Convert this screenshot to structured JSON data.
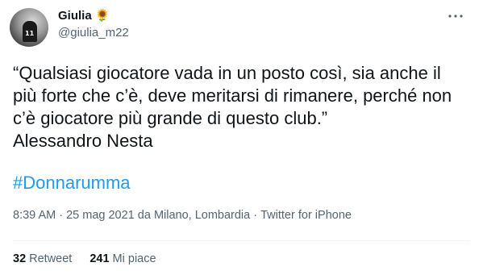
{
  "author": {
    "display_name": "Giulia",
    "emoji": "🌻",
    "handle": "@giulia_m22",
    "avatar_number": "11"
  },
  "tweet": {
    "text": "“Qualsiasi giocatore vada in un posto così, sia anche il\npiù forte che c’è, deve meritarsi di rimanere, perché non\nc’è giocatore più grande di questo club.”\nAlessandro Nesta",
    "hashtag": "#Donnarumma"
  },
  "meta": {
    "time": "8:39 AM",
    "sep1": " · ",
    "date": "25 mag 2021",
    "da": " da ",
    "location": "Milano, Lombardia",
    "sep2": " · ",
    "client": "Twitter for iPhone"
  },
  "stats": {
    "retweets_count": "32",
    "retweets_label": "Retweet",
    "likes_count": "241",
    "likes_label": "Mi piace"
  },
  "icons": {
    "more": "more-horizontal-icon"
  },
  "colors": {
    "text": "#0f1419",
    "secondary": "#536471",
    "link": "#1d9bf0",
    "divider": "#eff3f4"
  }
}
